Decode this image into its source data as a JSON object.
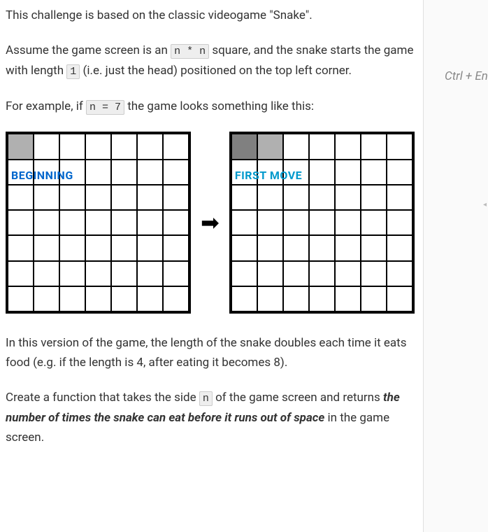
{
  "para1": "This challenge is based on the classic videogame \"Snake\".",
  "para2_a": "Assume the game screen is an ",
  "code1": "n * n",
  "para2_b": " square, and the snake starts the game with length ",
  "code2": "1",
  "para2_c": " (i.e. just the head) positioned on the top left corner.",
  "para3_a": "For example, if ",
  "code3": "n = 7",
  "para3_b": " the game looks something like this:",
  "label_beginning": "BEGINNING",
  "label_firstmove": "FIRST MOVE",
  "arrow": "➡",
  "para4": "In this version of the game, the length of the snake doubles each time it eats food (e.g. if the length is 4, after eating it becomes 8).",
  "para5_a": "Create a function that takes the side ",
  "code4": "n",
  "para5_b": " of the game screen and returns ",
  "para5_bold": "the number of times the snake can eat before it runs out of space",
  "para5_c": " in the game screen.",
  "shortcut": "Ctrl + En",
  "scroll_glyph": "◂"
}
